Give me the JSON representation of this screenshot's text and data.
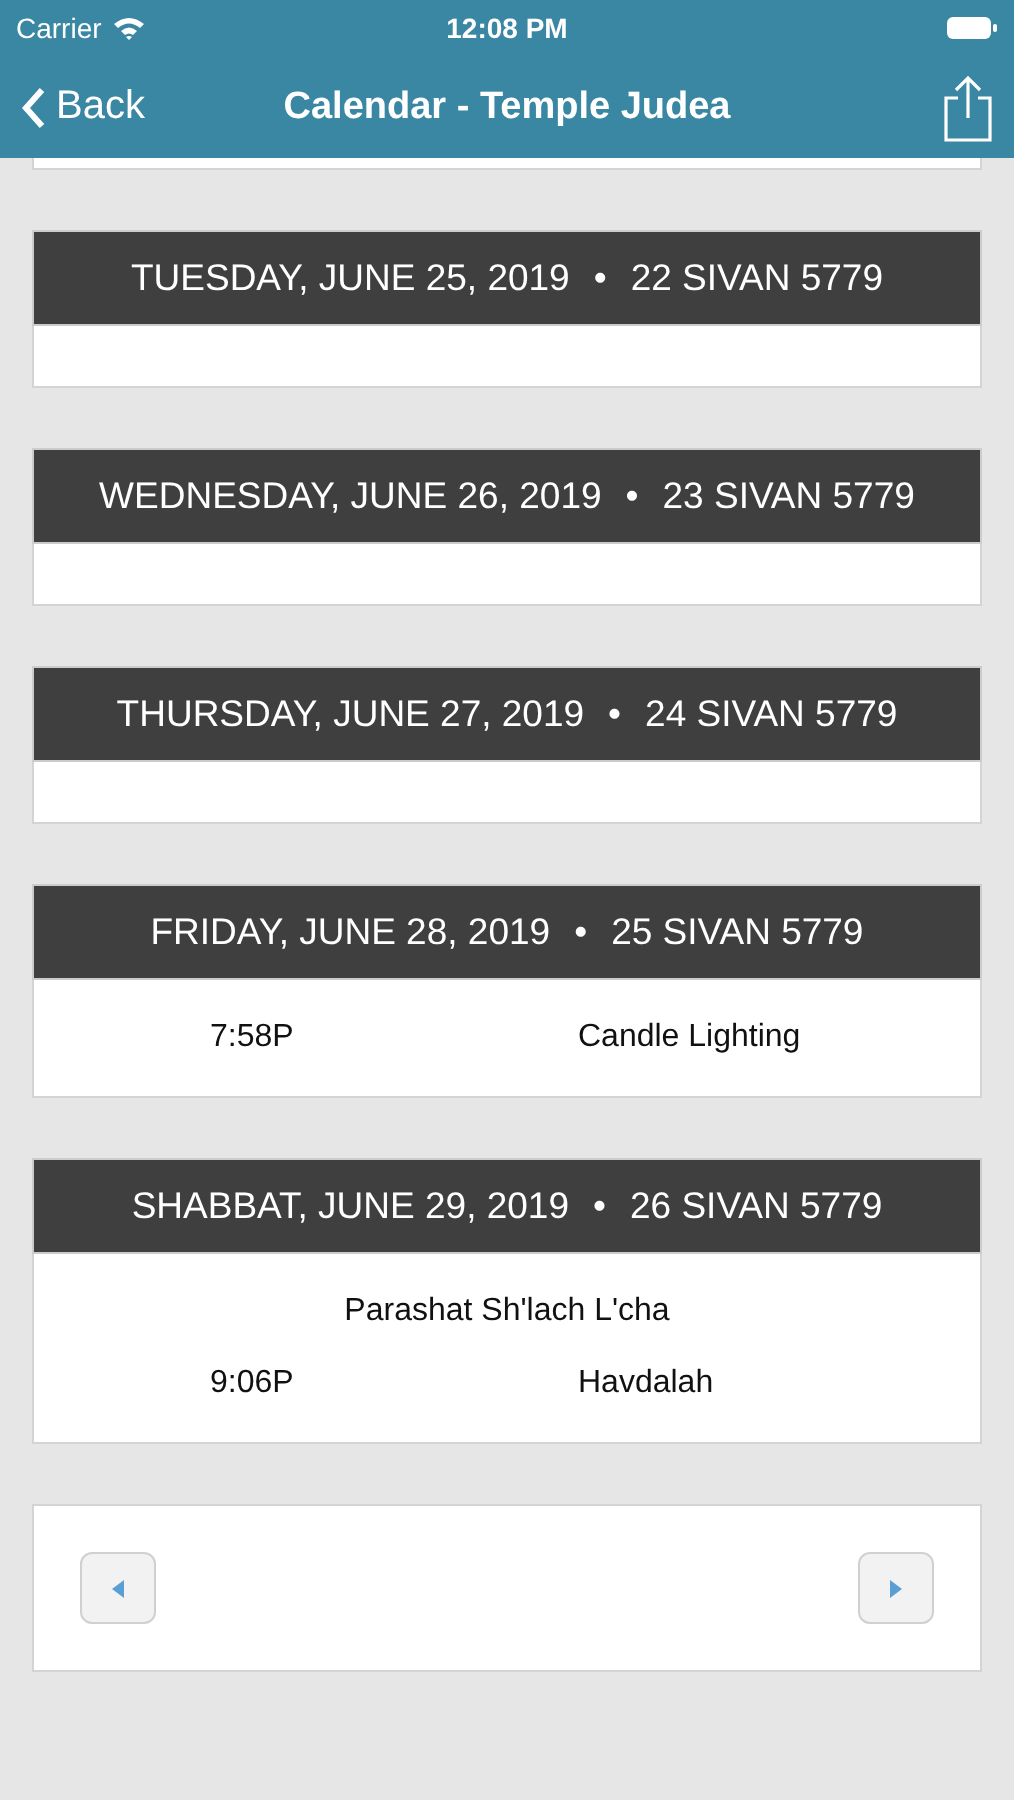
{
  "status_bar": {
    "carrier": "Carrier",
    "time": "12:08 PM"
  },
  "nav": {
    "back": "Back",
    "title": "Calendar - Temple Judea"
  },
  "days": [
    {
      "date": "TUESDAY, JUNE 25, 2019",
      "separator": "•",
      "hebrew_date": "22 SIVAN 5779"
    },
    {
      "date": "WEDNESDAY, JUNE 26, 2019",
      "separator": "•",
      "hebrew_date": "23 SIVAN 5779"
    },
    {
      "date": "THURSDAY, JUNE 27, 2019",
      "separator": "•",
      "hebrew_date": "24 SIVAN 5779"
    },
    {
      "date": "FRIDAY, JUNE 28, 2019",
      "separator": "•",
      "hebrew_date": "25 SIVAN 5779",
      "events": [
        {
          "kind": "timed",
          "time": "7:58P",
          "title": "Candle Lighting"
        }
      ]
    },
    {
      "date": "SHABBAT, JUNE 29, 2019",
      "separator": "•",
      "hebrew_date": "26 SIVAN 5779",
      "events": [
        {
          "kind": "note",
          "title": "Parashat Sh'lach L'cha"
        },
        {
          "kind": "timed",
          "time": "9:06P",
          "title": "Havdalah"
        }
      ]
    }
  ]
}
